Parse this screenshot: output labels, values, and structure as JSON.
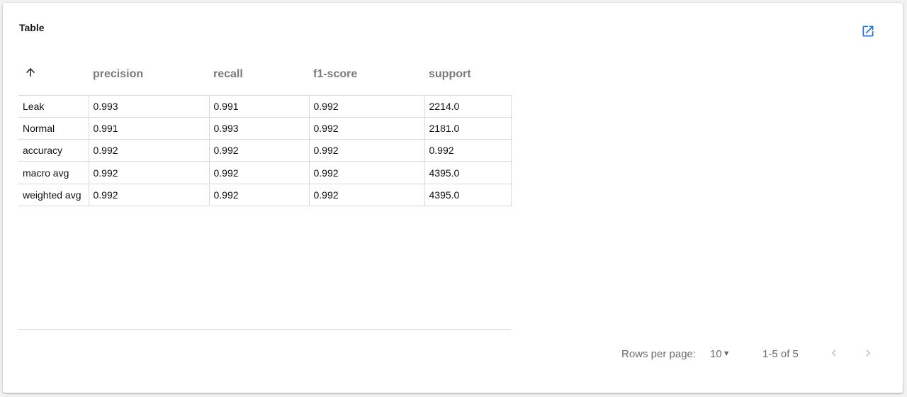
{
  "card": {
    "title": "Table",
    "open_icon": "open-in-new-icon",
    "accent_color": "#1a73e8"
  },
  "table": {
    "sort_icon": "arrow-up-icon",
    "columns": [
      "precision",
      "recall",
      "f1-score",
      "support"
    ],
    "rows": [
      {
        "label": "Leak",
        "values": [
          "0.993",
          "0.991",
          "0.992",
          "2214.0"
        ]
      },
      {
        "label": "Normal",
        "values": [
          "0.991",
          "0.993",
          "0.992",
          "2181.0"
        ]
      },
      {
        "label": "accuracy",
        "values": [
          "0.992",
          "0.992",
          "0.992",
          "0.992"
        ]
      },
      {
        "label": "macro avg",
        "values": [
          "0.992",
          "0.992",
          "0.992",
          "4395.0"
        ]
      },
      {
        "label": "weighted avg",
        "values": [
          "0.992",
          "0.992",
          "0.992",
          "4395.0"
        ]
      }
    ]
  },
  "pagination": {
    "rows_per_page_label": "Rows per page:",
    "rows_per_page_value": "10",
    "range_text": "1-5 of 5",
    "prev_icon": "chevron-left-icon",
    "next_icon": "chevron-right-icon"
  }
}
